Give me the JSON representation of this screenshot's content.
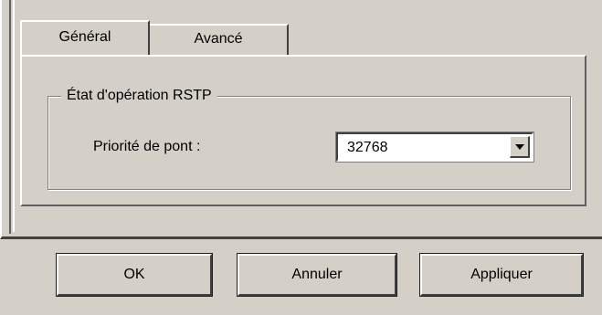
{
  "tabs": [
    {
      "label": "Général",
      "active": true
    },
    {
      "label": "Avancé",
      "active": false
    }
  ],
  "group": {
    "title": "État d'opération RSTP",
    "field_label": "Priorité de pont :",
    "combo_value": "32768",
    "combo_icon": "chevron-down-icon"
  },
  "buttons": {
    "ok": "OK",
    "cancel": "Annuler",
    "apply": "Appliquer"
  },
  "colors": {
    "face": "#d4d0c8",
    "highlight": "#ffffff",
    "shadow": "#404040"
  }
}
